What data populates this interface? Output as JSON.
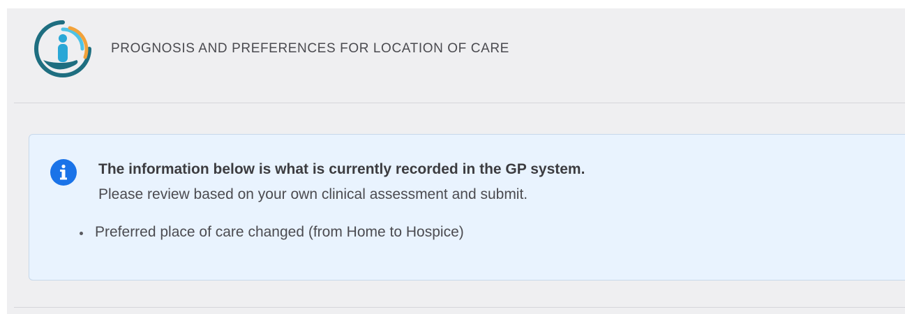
{
  "header": {
    "title": "PROGNOSIS AND PREFERENCES FOR LOCATION OF CARE",
    "logo_icon": "care-person-hand-logo"
  },
  "info_box": {
    "icon": "info-icon",
    "heading": "The information below is what is currently recorded in the GP system.",
    "subtext": "Please review based on your own clinical assessment and submit.",
    "items": [
      "Preferred place of care changed (from Home to Hospice)"
    ]
  },
  "colors": {
    "page_background": "#efeff1",
    "info_background": "#e9f3fe",
    "info_icon": "#1a73e8",
    "logo_teal": "#1e6e80",
    "logo_light_blue": "#4fc3e6",
    "logo_orange": "#f2a23a"
  }
}
